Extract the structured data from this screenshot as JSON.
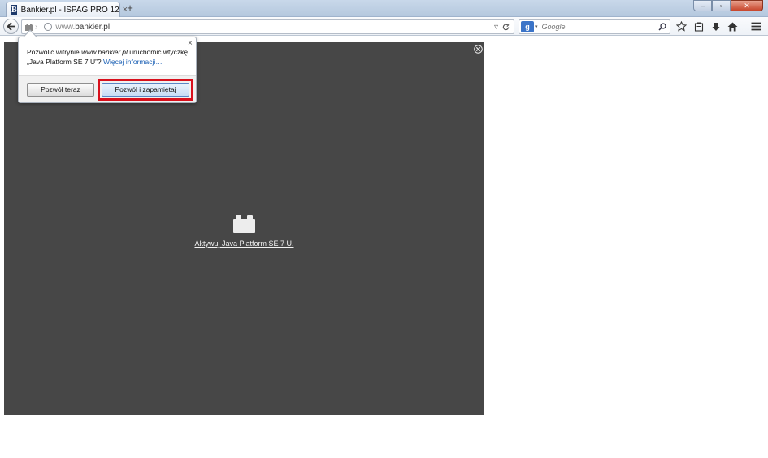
{
  "tab": {
    "title": "Bankier.pl - ISPAG PRO 12",
    "favicon_letter": "B",
    "close_glyph": "×",
    "new_tab_glyph": "+"
  },
  "window_controls": {
    "minimize": "–",
    "maximize": "▫",
    "close": "✕"
  },
  "urlbar": {
    "host_dim": "www.",
    "host": "bankier.pl"
  },
  "search": {
    "placeholder": "Google",
    "engine_letter": "g"
  },
  "popup": {
    "msg_1": "Pozwolić witrynie ",
    "msg_site": "www.bankier.pl",
    "msg_2": " uruchomić wtyczkę „Java Platform SE 7 U”? ",
    "more_link": "Więcej informacji…",
    "close_glyph": "×",
    "allow_now_label": "Pozwól teraz",
    "allow_remember_label": "Pozwól i zapamiętaj"
  },
  "plugin": {
    "activate_link": "Aktywuj Java Platform SE 7 U."
  },
  "colors": {
    "plugin_bg": "#474747",
    "highlight": "#d8101c",
    "link": "#1a5fb4"
  }
}
